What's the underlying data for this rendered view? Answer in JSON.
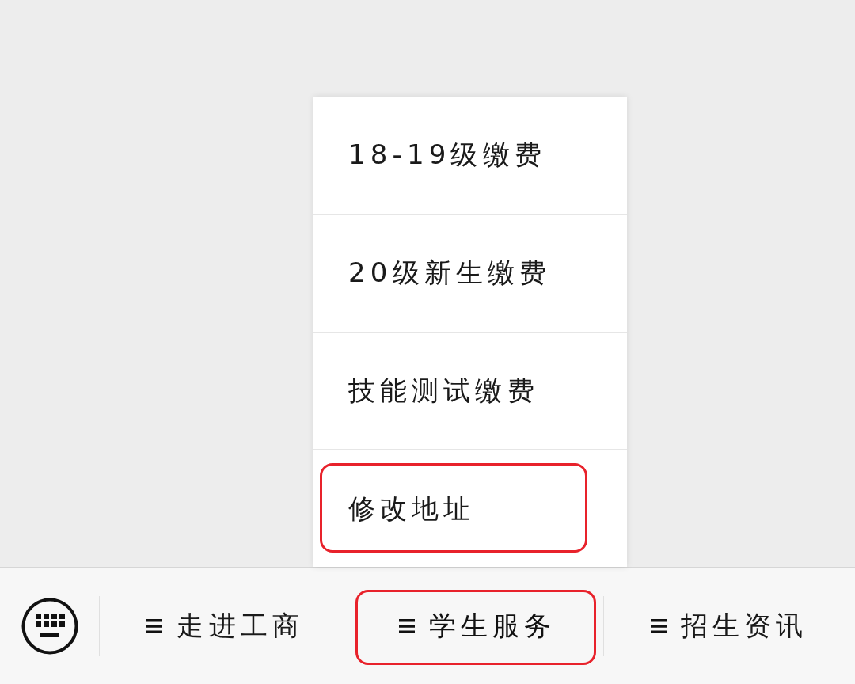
{
  "submenu": {
    "items": [
      {
        "label": "18-19级缴费",
        "annotated": false
      },
      {
        "label": "20级新生缴费",
        "annotated": false
      },
      {
        "label": "技能测试缴费",
        "annotated": false
      },
      {
        "label": "修改地址",
        "annotated": true
      }
    ]
  },
  "menu_bar": {
    "items": [
      {
        "label": "走进工商",
        "expanded": false,
        "annotated": false
      },
      {
        "label": "学生服务",
        "expanded": true,
        "annotated": true
      },
      {
        "label": "招生资讯",
        "expanded": false,
        "annotated": false
      }
    ]
  }
}
